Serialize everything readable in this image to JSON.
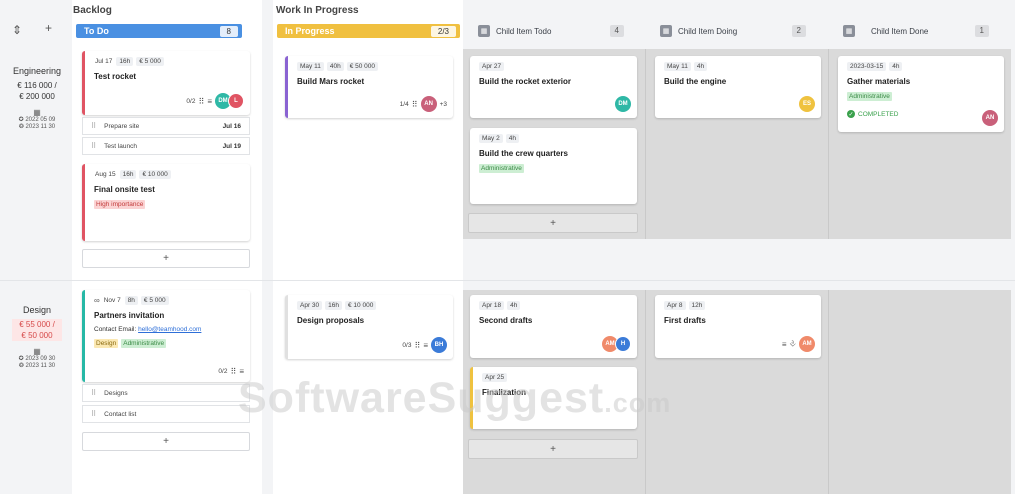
{
  "groups": {
    "backlog": "Backlog",
    "wip": "Work In Progress"
  },
  "columns": {
    "todo": {
      "name": "To Do",
      "count": "8",
      "color": "#4a90e2"
    },
    "inprogress": {
      "name": "In Progress",
      "count": "2/3",
      "color": "#f0c040"
    },
    "child_todo": {
      "name": "Child Item Todo",
      "count": "4"
    },
    "child_doing": {
      "name": "Child Item Doing",
      "count": "2"
    },
    "child_done": {
      "name": "Child Item Done",
      "count": "1"
    }
  },
  "controls": {
    "collapse": "⇕",
    "add": "+"
  },
  "lanes": {
    "engineering": {
      "name": "Engineering",
      "value1": "€ 116 000 /",
      "value2": "€ 200 000",
      "calendar": "▦",
      "date1": "✪ 2022 05 09",
      "date2": "❂ 2023 11 30"
    },
    "design": {
      "name": "Design",
      "value1": "€ 55 000 /",
      "value2": "€ 50 000",
      "calendar": "▦",
      "date1": "✪ 2023 09 30",
      "date2": "❂ 2023 11 30"
    }
  },
  "cards": {
    "test_rocket": {
      "date": "Jul 17",
      "hours": "16h",
      "cost": "€ 5 000",
      "title": "Test rocket",
      "sub": "0/2",
      "av1": "DM",
      "av2": "L"
    },
    "prepare_site": {
      "label": "Prepare site",
      "date": "Jul 16"
    },
    "test_launch": {
      "label": "Test launch",
      "date": "Jul 19"
    },
    "final_test": {
      "date": "Aug 15",
      "hours": "16h",
      "cost": "€ 10 000",
      "title": "Final onsite test",
      "tag": "High importance"
    },
    "mars_rocket": {
      "date": "May 11",
      "hours": "40h",
      "cost": "€ 50 000",
      "title": "Build Mars rocket",
      "sub": "1/4",
      "av1": "AN",
      "more": "+3"
    },
    "rocket_exterior": {
      "date": "Apr 27",
      "title": "Build the rocket exterior",
      "av1": "DM"
    },
    "crew_quarters": {
      "date": "May 2",
      "hours": "4h",
      "title": "Build the crew quarters",
      "tag": "Administrative"
    },
    "build_engine": {
      "date": "May 11",
      "hours": "4h",
      "title": "Build the engine",
      "av1": "ES"
    },
    "gather_materials": {
      "date": "2023-03-15",
      "hours": "4h",
      "title": "Gather materials",
      "tag": "Administrative",
      "status": "COMPLETED",
      "av1": "AN"
    },
    "partners": {
      "date": "Nov 7",
      "hours": "8h",
      "cost": "€ 5 000",
      "title": "Partners invitation",
      "contact_label": "Contact Email: ",
      "contact_email": "hello@teamhood.com",
      "tag1": "Design",
      "tag2": "Administrative",
      "sub": "0/2"
    },
    "designs": {
      "label": "Designs"
    },
    "contact_list": {
      "label": "Contact list"
    },
    "design_proposals": {
      "date": "Apr 30",
      "hours": "16h",
      "cost": "€ 10 000",
      "title": "Design proposals",
      "sub": "0/3",
      "av1": "BH"
    },
    "second_drafts": {
      "date": "Apr 18",
      "hours": "4h",
      "title": "Second drafts",
      "av1": "AM",
      "av2": "H"
    },
    "finalization": {
      "date": "Apr 25",
      "title": "Finalization"
    },
    "first_drafts": {
      "date": "Apr 8",
      "hours": "12h",
      "title": "First drafts",
      "av1": "AM"
    }
  },
  "add_label": "+",
  "watermark": {
    "main": "SoftwareSuggest",
    "suffix": ".com"
  },
  "icons": {
    "subtask": "subtask-icon",
    "description": "description-icon",
    "attachment": "paperclip-icon",
    "link": "link-icon",
    "check": "check-icon"
  }
}
